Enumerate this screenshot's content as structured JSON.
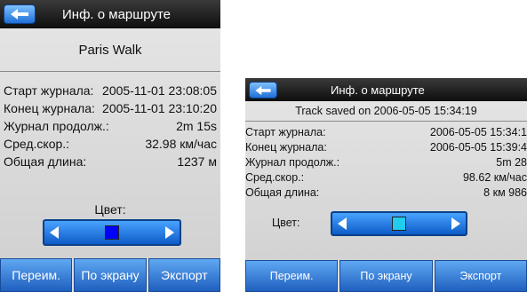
{
  "screen1": {
    "title": "Инф. о маршруте",
    "route_name": "Paris Walk",
    "rows": [
      {
        "label": "Старт журнала:",
        "value": "2005-11-01 23:08:05"
      },
      {
        "label": "Конец журнала:",
        "value": "2005-11-01 23:10:20"
      },
      {
        "label": "Журнал продолж.:",
        "value": "2m 15s"
      },
      {
        "label": "Сред.скор.:",
        "value": "32.98 км/час"
      },
      {
        "label": "Общая длина:",
        "value": "1237 м"
      }
    ],
    "color_label": "Цвет:",
    "swatch_color": "#0000ff",
    "buttons": {
      "rename": "Переим.",
      "on_screen": "По экрану",
      "export": "Экспорт"
    }
  },
  "screen2": {
    "title": "Инф. о маршруте",
    "saved": "Track saved on 2006-05-05 15:34:19",
    "rows": [
      {
        "label": "Старт журнала:",
        "value": "2006-05-05 15:34:1"
      },
      {
        "label": "Конец журнала:",
        "value": "2006-05-05 15:39:4"
      },
      {
        "label": "Журнал продолж.:",
        "value": "5m 28"
      },
      {
        "label": "Сред.скор.:",
        "value": "98.62 км/час"
      },
      {
        "label": "Общая длина:",
        "value": "8 км 986"
      }
    ],
    "color_label": "Цвет:",
    "swatch_color": "#22ccee",
    "buttons": {
      "rename": "Переим.",
      "on_screen": "По экрану",
      "export": "Экспорт"
    }
  },
  "icons": {
    "back": "back-arrow-icon",
    "prev": "arrow-left-icon",
    "next": "arrow-right-icon"
  }
}
